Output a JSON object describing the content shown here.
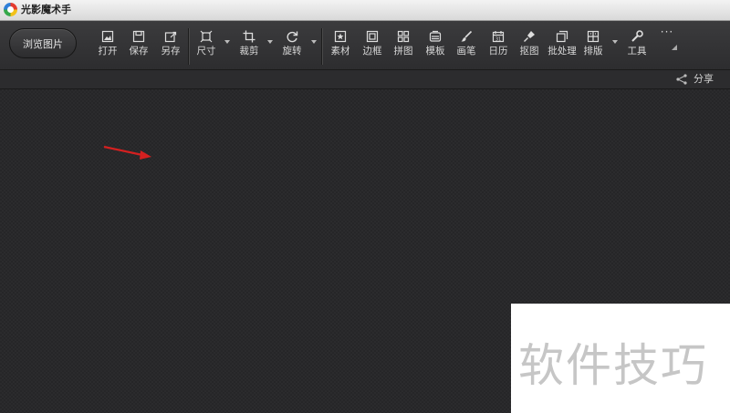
{
  "window": {
    "title": "光影魔术手"
  },
  "toolbar": {
    "browse_label": "浏览图片",
    "tools": [
      {
        "label": "打开",
        "icon": "open-icon"
      },
      {
        "label": "保存",
        "icon": "save-icon"
      },
      {
        "label": "另存",
        "icon": "save-as-icon"
      },
      {
        "label": "尺寸",
        "icon": "resize-icon"
      },
      {
        "label": "裁剪",
        "icon": "crop-icon"
      },
      {
        "label": "旋转",
        "icon": "rotate-icon"
      },
      {
        "label": "素材",
        "icon": "material-icon"
      },
      {
        "label": "边框",
        "icon": "border-icon"
      },
      {
        "label": "拼图",
        "icon": "collage-icon"
      },
      {
        "label": "模板",
        "icon": "template-icon"
      },
      {
        "label": "画笔",
        "icon": "brush-icon"
      },
      {
        "label": "日历",
        "icon": "calendar-icon"
      },
      {
        "label": "抠图",
        "icon": "cutout-icon"
      },
      {
        "label": "批处理",
        "icon": "batch-icon"
      },
      {
        "label": "排版",
        "icon": "layout-icon"
      },
      {
        "label": "工具",
        "icon": "tools-icon"
      }
    ],
    "more_label": "···"
  },
  "subbar": {
    "share_label": "分享"
  },
  "watermark": {
    "text": "软件技巧"
  },
  "colors": {
    "arrow": "#d42020",
    "background": "#262628",
    "toolbar": "#333335"
  }
}
